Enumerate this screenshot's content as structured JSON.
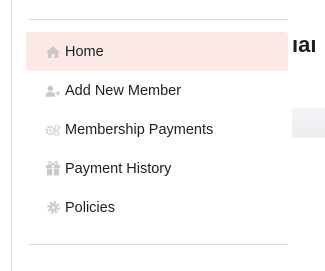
{
  "sidebar": {
    "items": [
      {
        "label": "Home",
        "icon": "home-icon",
        "active": true
      },
      {
        "label": "Add New Member",
        "icon": "user-plus-icon",
        "active": false
      },
      {
        "label": "Membership Payments",
        "icon": "cogs-icon",
        "active": false
      },
      {
        "label": "Payment History",
        "icon": "gift-icon",
        "active": false
      },
      {
        "label": "Policies",
        "icon": "gear-icon",
        "active": false
      }
    ]
  },
  "main": {
    "heading_fragment": "ıaı"
  },
  "colors": {
    "active_bg": "#fbe9e8",
    "icon_gray": "#c9c9c9",
    "text": "#1f1f1f"
  }
}
